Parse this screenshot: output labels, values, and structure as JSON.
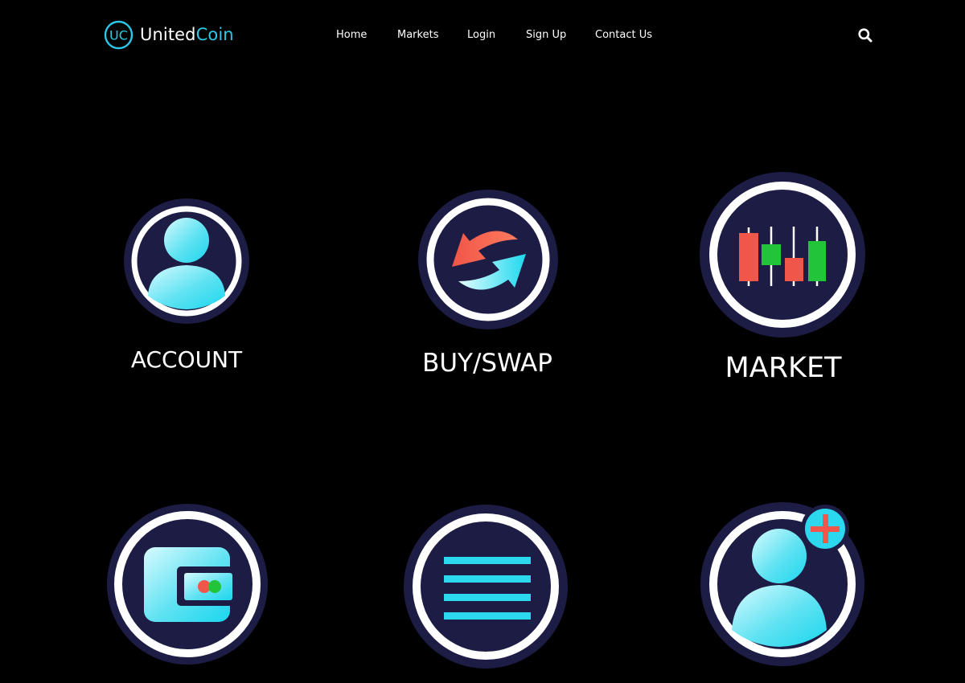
{
  "header": {
    "logo": {
      "monogram": "UC",
      "word1": "United",
      "word2": "Coin"
    },
    "nav": [
      {
        "label": "Home"
      },
      {
        "label": "Markets"
      },
      {
        "label": "Login"
      },
      {
        "label": "Sign Up"
      },
      {
        "label": "Contact Us"
      }
    ],
    "search_icon": "search-icon"
  },
  "tiles": [
    {
      "label": "ACCOUNT",
      "icon": "user-icon"
    },
    {
      "label": "BUY/SWAP",
      "icon": "swap-arrows-icon"
    },
    {
      "label": "MARKET",
      "icon": "candlestick-chart-icon"
    },
    {
      "label": "",
      "icon": "wallet-icon"
    },
    {
      "label": "",
      "icon": "list-lines-icon"
    },
    {
      "label": "",
      "icon": "add-user-icon"
    }
  ],
  "colors": {
    "background": "#000000",
    "accent_cyan": "#2cc8e8",
    "circle_fill": "#1c1c44",
    "ring": "#ffffff",
    "candle_red": "#f0574a",
    "candle_green": "#22c43a"
  }
}
